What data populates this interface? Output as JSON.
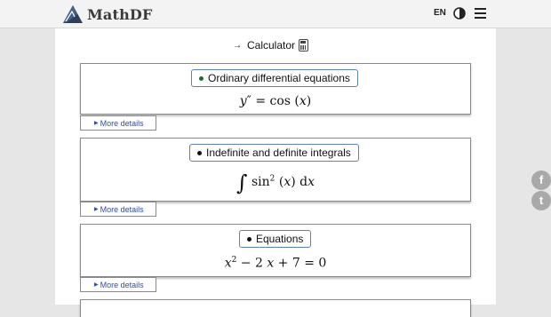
{
  "header": {
    "logo_text": "MathDF",
    "language": "EN"
  },
  "calculator_link": {
    "arrow": "→",
    "label": "Calculator"
  },
  "cards": [
    {
      "title": "Ordinary differential equations",
      "dot_color": "#1f6b2e",
      "details": "More details"
    },
    {
      "title": "Indefinite and definite integrals",
      "dot_color": "#111111",
      "details": "More details"
    },
    {
      "title": "Equations",
      "dot_color": "#111111",
      "details": "More details"
    }
  ],
  "social": {
    "facebook": "f",
    "twitter": "t"
  }
}
